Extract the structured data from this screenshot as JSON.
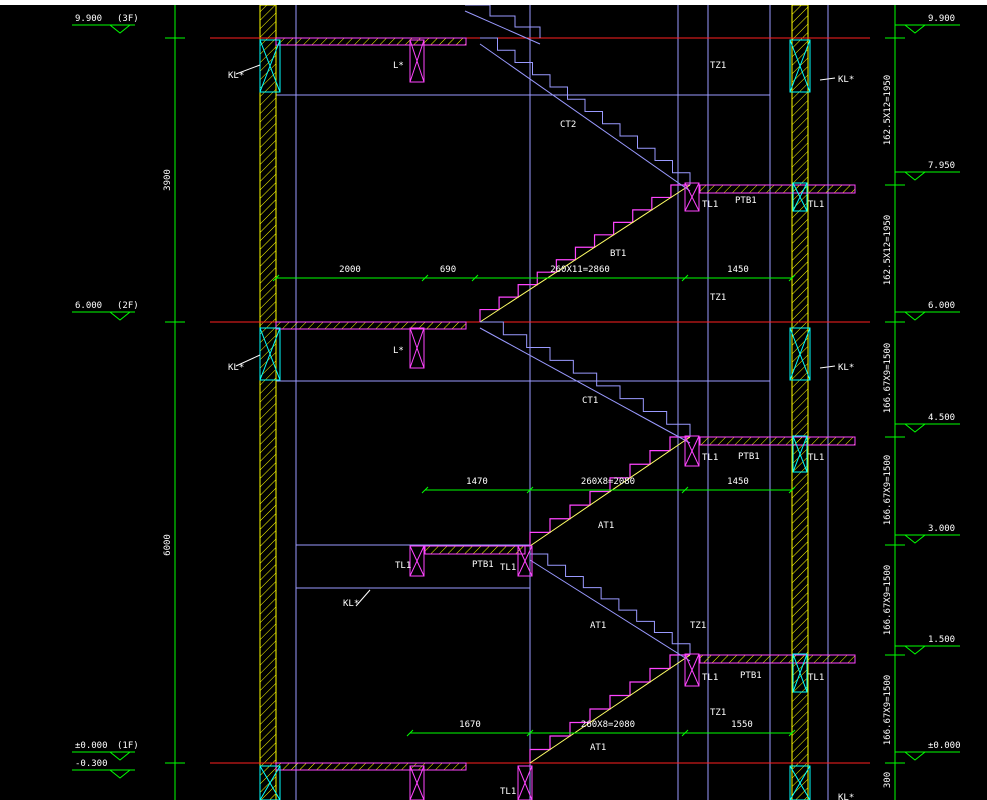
{
  "elevations": {
    "left": [
      {
        "value": "9.900",
        "floor": "(3F)"
      },
      {
        "value": "6.000",
        "floor": "(2F)"
      },
      {
        "value": "±0.000",
        "floor": "(1F)"
      },
      {
        "value": "-0.300",
        "floor": ""
      }
    ],
    "right": [
      "9.900",
      "7.950",
      "6.000",
      "4.500",
      "3.000",
      "1.500",
      "±0.000"
    ]
  },
  "dimensions": {
    "left": [
      "3900",
      "6000"
    ],
    "right": [
      "162.5X12=1950",
      "162.5X12=1950",
      "166.67X9=1500",
      "166.67X9=1500",
      "166.67X9=1500",
      "166.67X9=1500",
      "300"
    ],
    "horizontal": [
      [
        "2000",
        "690",
        "260X11=2860",
        "1450"
      ],
      [
        "1470",
        "260X8=2080",
        "1450"
      ],
      [
        "1670",
        "260X8=2080",
        "1550"
      ]
    ]
  },
  "labels": {
    "beams": [
      "KL*",
      "KL*",
      "KL*",
      "KL*",
      "KL*",
      "KL*"
    ],
    "l_beams": [
      "L*",
      "L*"
    ],
    "stairs": [
      "CT2",
      "BT1",
      "CT1",
      "AT1",
      "AT1",
      "AT1"
    ],
    "columns": [
      "TZ1",
      "TZ1",
      "TZ1",
      "TZ1"
    ],
    "landing_beams": [
      "TL1",
      "TL1",
      "TL1",
      "TL1",
      "TL1",
      "TL1",
      "TL1",
      "TL1",
      "TL1"
    ],
    "slabs": [
      "PTB1",
      "PTB1",
      "PTB1",
      "PTB1"
    ]
  },
  "colors": {
    "floor_line": "#ff2020",
    "dimension": "#00ff00",
    "stair": "#ff44ff",
    "beam_box": "#00ffff",
    "grid": "#9a9aff",
    "wall_hatch": "#ffff00",
    "text": "#ffffff"
  }
}
